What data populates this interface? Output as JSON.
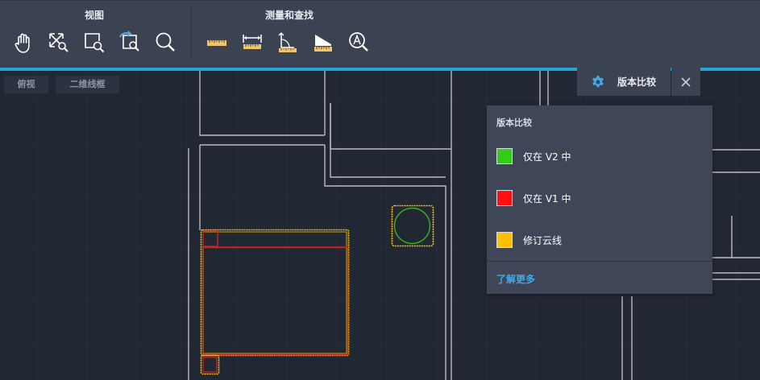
{
  "toolbar": {
    "view_group": {
      "label": "视图",
      "tools": [
        {
          "icon": "pan-hand-icon"
        },
        {
          "icon": "zoom-extents-icon"
        },
        {
          "icon": "zoom-window-icon"
        },
        {
          "icon": "zoom-previous-icon"
        },
        {
          "icon": "zoom-magnifier-icon"
        }
      ]
    },
    "measure_group": {
      "label": "测量和查找",
      "tools": [
        {
          "icon": "measure-ruler-icon"
        },
        {
          "icon": "measure-distance-icon"
        },
        {
          "icon": "measure-angle-icon"
        },
        {
          "icon": "measure-area-icon"
        },
        {
          "icon": "find-text-icon"
        }
      ]
    },
    "accent_color": "#2aa3d8"
  },
  "viewport": {
    "view_label": "俯视",
    "style_label": "二维线框"
  },
  "compare_tab": {
    "label": "版本比较",
    "gear_icon": "gear-icon",
    "close_icon": "close-icon"
  },
  "compare_popup": {
    "title": "版本比较",
    "legend": [
      {
        "label": "仅在 V2 中",
        "color": "#33cc1a"
      },
      {
        "label": "仅在 V1 中",
        "color": "#ff1111"
      },
      {
        "label": "修订云线",
        "color": "#ffc000"
      }
    ],
    "learn_more": "了解更多"
  }
}
